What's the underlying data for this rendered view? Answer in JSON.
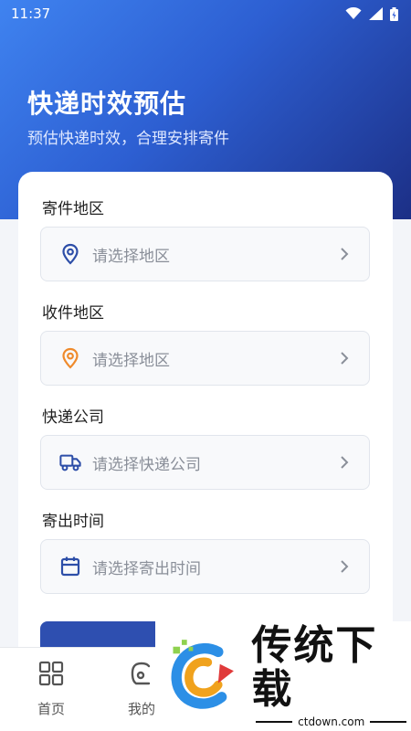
{
  "status_bar": {
    "time": "11:37"
  },
  "header": {
    "title": "快递时效预估",
    "subtitle": "预估快递时效，合理安排寄件"
  },
  "form": {
    "fields": [
      {
        "label": "寄件地区",
        "placeholder": "请选择地区",
        "icon": "location-pin-icon",
        "icon_color": "#2d4ea8"
      },
      {
        "label": "收件地区",
        "placeholder": "请选择地区",
        "icon": "location-pin-icon",
        "icon_color": "#ef8a2b"
      },
      {
        "label": "快递公司",
        "placeholder": "请选择快递公司",
        "icon": "truck-icon",
        "icon_color": "#2d4ea8"
      },
      {
        "label": "寄出时间",
        "placeholder": "请选择寄出时间",
        "icon": "calendar-icon",
        "icon_color": "#2d4ea8"
      }
    ]
  },
  "tabbar": {
    "items": [
      {
        "label": "首页",
        "icon": "grid-icon"
      },
      {
        "label": "我的",
        "icon": "profile-icon"
      }
    ]
  },
  "watermark": {
    "brand": "传统下载",
    "url": "ctdown.com"
  },
  "colors": {
    "primary": "#2d4ea8",
    "accent": "#ef8a2b",
    "hero_start": "#3f83f0",
    "hero_end": "#1c2f86"
  }
}
